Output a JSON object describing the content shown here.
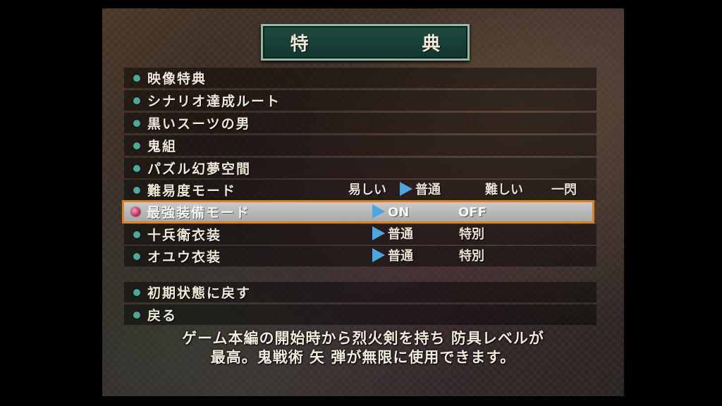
{
  "title": "特 典",
  "menu": [
    {
      "label": "映像特典"
    },
    {
      "label": "シナリオ達成ルート"
    },
    {
      "label": "黒いスーツの男"
    },
    {
      "label": "鬼組"
    },
    {
      "label": "パズル幻夢空間"
    },
    {
      "label": "難易度モード",
      "options": [
        "易しい",
        "普通",
        "難しい",
        "一閃"
      ],
      "selected": "普通"
    },
    {
      "label": "最強装備モード",
      "options": [
        "ON",
        "OFF"
      ],
      "selected": "ON",
      "highlighted": true
    },
    {
      "label": "十兵衛衣装",
      "options": [
        "普通",
        "特別"
      ],
      "selected": "普通"
    },
    {
      "label": "オユウ衣装",
      "options": [
        "普通",
        "特別"
      ],
      "selected": "普通"
    }
  ],
  "footer_menu": [
    {
      "label": "初期状態に戻す"
    },
    {
      "label": "戻る"
    }
  ],
  "description": {
    "line1": "ゲーム本編の開始時から烈火剣を持ち 防具レベルが",
    "line2": "最高。鬼戦術 矢 弾が無限に使用できます。"
  },
  "colors": {
    "title_bg": "#1f4a40",
    "bullet": "#4fa89a",
    "selected_arrow": "#4da6e0",
    "highlight_border": "#d9822b",
    "highlight_bullet": "#c21848"
  }
}
